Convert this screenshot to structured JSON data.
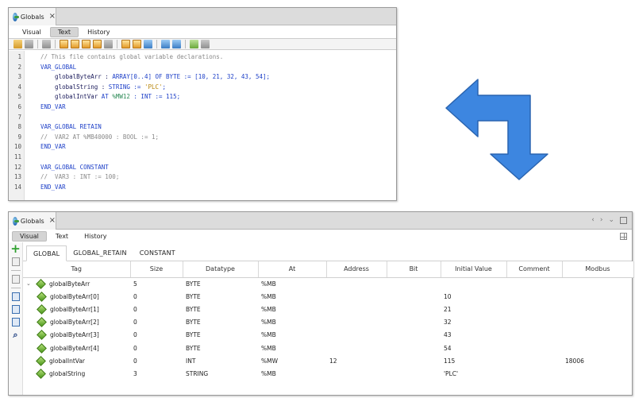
{
  "top_window": {
    "tab_title": "Globals",
    "subtabs": [
      "Visual",
      "Text",
      "History"
    ],
    "active_subtab": "Text",
    "line_numbers": [
      "1",
      "2",
      "3",
      "4",
      "5",
      "6",
      "7",
      "8",
      "9",
      "10",
      "11",
      "12",
      "13",
      "14"
    ],
    "code_lines": [
      [
        {
          "t": "// This file contains global variable declarations.",
          "k": "comment"
        }
      ],
      [
        {
          "t": "VAR_GLOBAL",
          "k": "kw"
        }
      ],
      [
        {
          "t": "    globalByteArr : ",
          "k": "id"
        },
        {
          "t": "ARRAY[",
          "k": "kw"
        },
        {
          "t": "0",
          "k": "num"
        },
        {
          "t": "..",
          "k": "kw"
        },
        {
          "t": "4",
          "k": "num"
        },
        {
          "t": "] OF BYTE := [",
          "k": "kw"
        },
        {
          "t": "10",
          "k": "num"
        },
        {
          "t": ", ",
          "k": "kw"
        },
        {
          "t": "21",
          "k": "num"
        },
        {
          "t": ", ",
          "k": "kw"
        },
        {
          "t": "32",
          "k": "num"
        },
        {
          "t": ", ",
          "k": "kw"
        },
        {
          "t": "43",
          "k": "num"
        },
        {
          "t": ", ",
          "k": "kw"
        },
        {
          "t": "54",
          "k": "num"
        },
        {
          "t": "];",
          "k": "kw"
        }
      ],
      [
        {
          "t": "    globalString : ",
          "k": "id"
        },
        {
          "t": "STRING := ",
          "k": "kw"
        },
        {
          "t": "'PLC'",
          "k": "str"
        },
        {
          "t": ";",
          "k": "kw"
        }
      ],
      [
        {
          "t": "    globalIntVar ",
          "k": "id"
        },
        {
          "t": "AT ",
          "k": "kw"
        },
        {
          "t": "%MW12",
          "k": "addr"
        },
        {
          "t": " : INT := ",
          "k": "kw"
        },
        {
          "t": "115",
          "k": "num"
        },
        {
          "t": ";",
          "k": "kw"
        }
      ],
      [
        {
          "t": "END_VAR",
          "k": "kw"
        }
      ],
      [
        {
          "t": "",
          "k": "id"
        }
      ],
      [
        {
          "t": "VAR_GLOBAL RETAIN",
          "k": "kw"
        }
      ],
      [
        {
          "t": "//  VAR2 AT %MB40000 : BOOL := 1;",
          "k": "comment"
        }
      ],
      [
        {
          "t": "END_VAR",
          "k": "kw"
        }
      ],
      [
        {
          "t": "",
          "k": "id"
        }
      ],
      [
        {
          "t": "VAR_GLOBAL CONSTANT",
          "k": "kw"
        }
      ],
      [
        {
          "t": "//  VAR3 : INT := 100;",
          "k": "comment"
        }
      ],
      [
        {
          "t": "END_VAR",
          "k": "kw"
        }
      ]
    ]
  },
  "bottom_window": {
    "tab_title": "Globals",
    "subtabs": [
      "Visual",
      "Text",
      "History"
    ],
    "active_subtab": "Visual",
    "section_tabs": [
      "GLOBAL",
      "GLOBAL_RETAIN",
      "CONSTANT"
    ],
    "active_section": "GLOBAL",
    "columns": [
      "Tag",
      "Size",
      "Datatype",
      "At",
      "Address",
      "Bit",
      "Initial Value",
      "Comment",
      "Modbus"
    ],
    "rows": [
      {
        "level": 0,
        "expandable": true,
        "tag": "globalByteArr",
        "size": "5",
        "datatype": "BYTE",
        "at": "%MB",
        "address": "",
        "bit": "",
        "initial": "",
        "comment": "",
        "modbus": ""
      },
      {
        "level": 1,
        "expandable": false,
        "tag": "globalByteArr[0]",
        "size": "0",
        "datatype": "BYTE",
        "at": "%MB",
        "address": "",
        "bit": "",
        "initial": "10",
        "comment": "",
        "modbus": ""
      },
      {
        "level": 1,
        "expandable": false,
        "tag": "globalByteArr[1]",
        "size": "0",
        "datatype": "BYTE",
        "at": "%MB",
        "address": "",
        "bit": "",
        "initial": "21",
        "comment": "",
        "modbus": ""
      },
      {
        "level": 1,
        "expandable": false,
        "tag": "globalByteArr[2]",
        "size": "0",
        "datatype": "BYTE",
        "at": "%MB",
        "address": "",
        "bit": "",
        "initial": "32",
        "comment": "",
        "modbus": ""
      },
      {
        "level": 1,
        "expandable": false,
        "tag": "globalByteArr[3]",
        "size": "0",
        "datatype": "BYTE",
        "at": "%MB",
        "address": "",
        "bit": "",
        "initial": "43",
        "comment": "",
        "modbus": ""
      },
      {
        "level": 1,
        "expandable": false,
        "tag": "globalByteArr[4]",
        "size": "0",
        "datatype": "BYTE",
        "at": "%MB",
        "address": "",
        "bit": "",
        "initial": "54",
        "comment": "",
        "modbus": ""
      },
      {
        "level": 0,
        "expandable": false,
        "tag": "globalIntVar",
        "size": "0",
        "datatype": "INT",
        "at": "%MW",
        "address": "12",
        "bit": "",
        "initial": "115",
        "comment": "",
        "modbus": "18006"
      },
      {
        "level": 0,
        "expandable": false,
        "tag": "globalString",
        "size": "3",
        "datatype": "STRING",
        "at": "%MB",
        "address": "",
        "bit": "",
        "initial": "'PLC'",
        "comment": "",
        "modbus": ""
      }
    ]
  },
  "colors": {
    "arrow": "#3d86e0",
    "arrow_outline": "#2a64b0",
    "add_icon": "#2ea02e",
    "tag_icon": "#6aaa2a"
  },
  "icons": [
    "globe-icon",
    "close-icon",
    "add-icon",
    "search-icon",
    "tag-diamond-icon",
    "expand-arrow-icon"
  ]
}
